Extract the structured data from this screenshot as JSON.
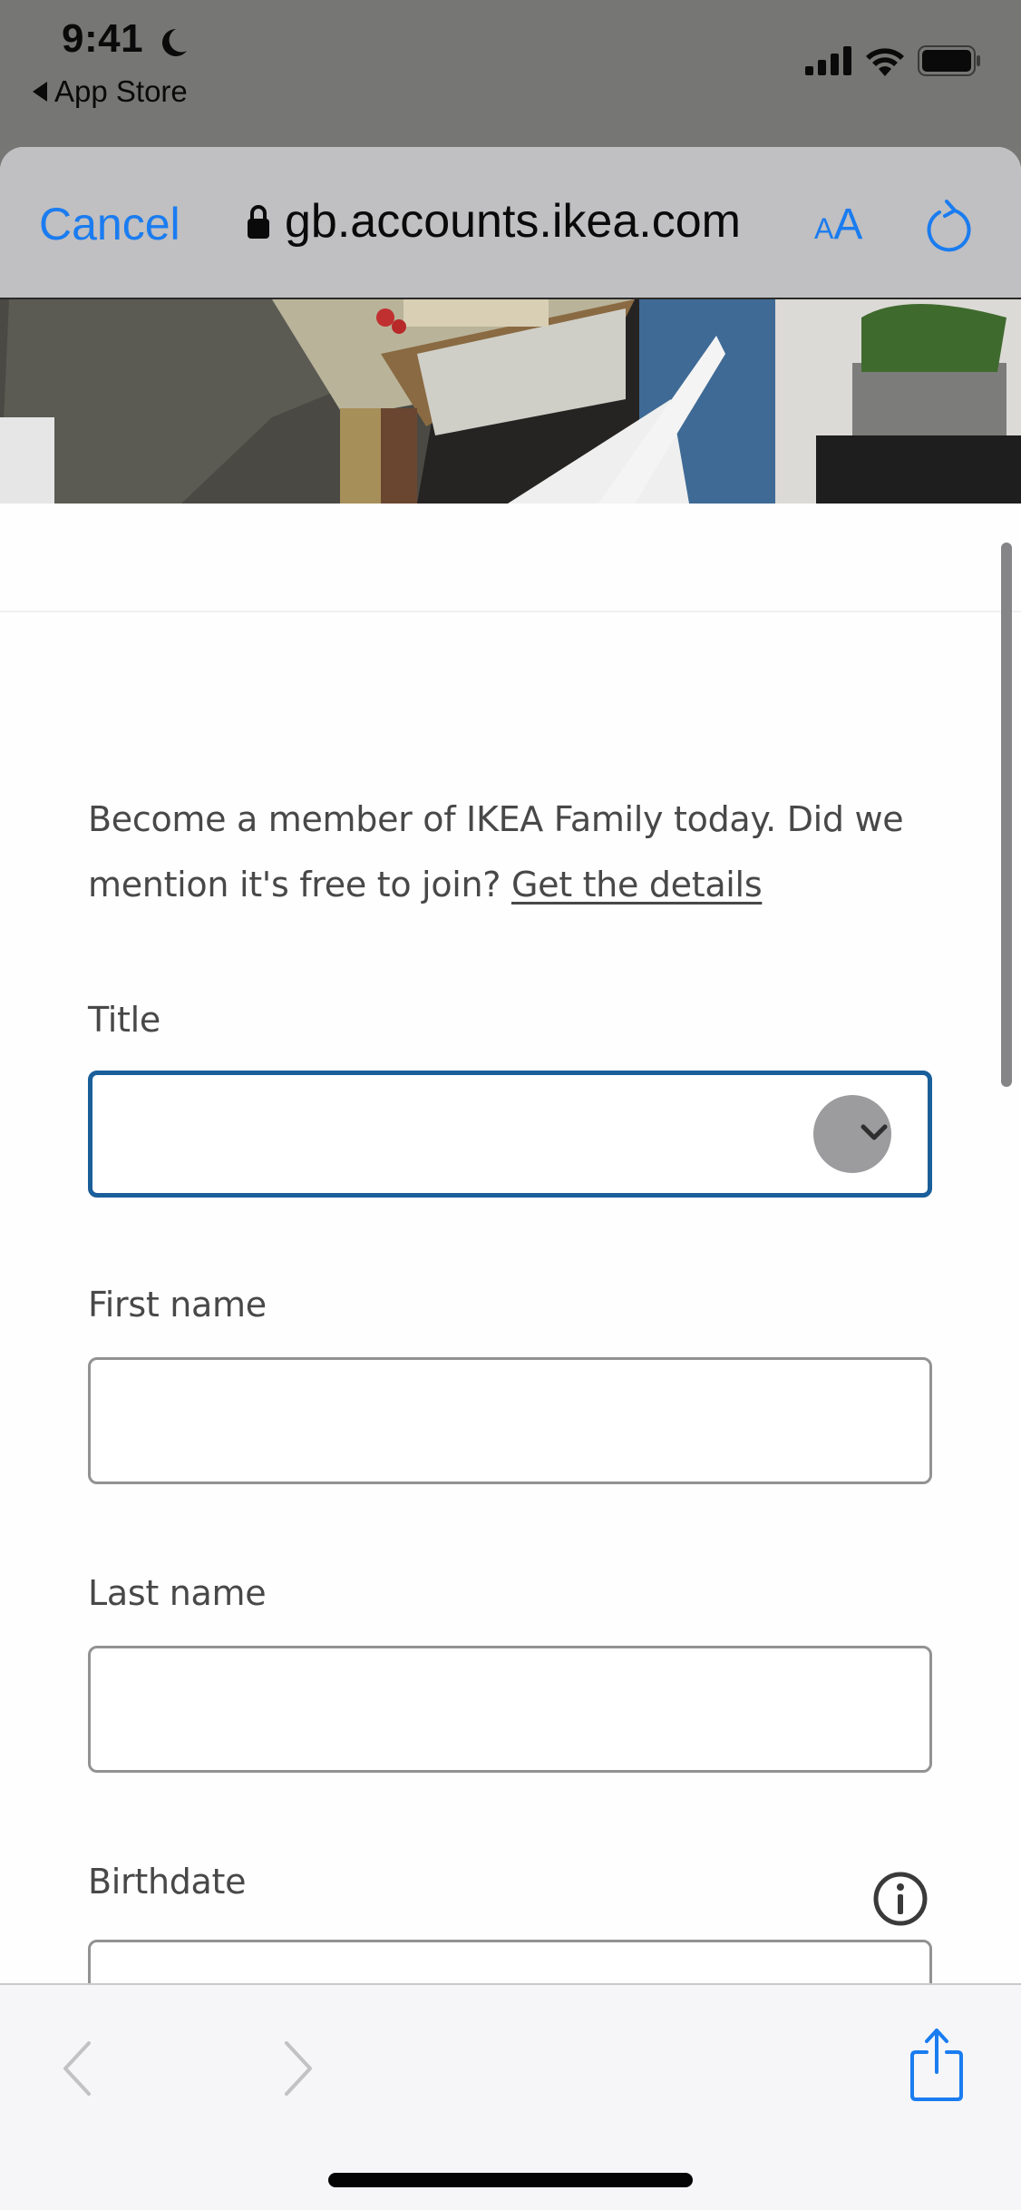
{
  "status_bar": {
    "time": "9:41",
    "back_app_label": "App Store",
    "icons": [
      "moon-icon",
      "cellular-signal-icon",
      "wifi-icon",
      "battery-icon"
    ]
  },
  "browser": {
    "cancel_label": "Cancel",
    "url": "gb.accounts.ikea.com",
    "text_size_small": "A",
    "text_size_large": "A",
    "accent_color": "#1a7cf0"
  },
  "page": {
    "intro_text": "Become a member of IKEA Family today. Did we mention it's free to join? ",
    "intro_link": "Get the details",
    "fields": {
      "title": {
        "label": "Title",
        "value": ""
      },
      "first_name": {
        "label": "First name",
        "value": ""
      },
      "last_name": {
        "label": "Last name",
        "value": ""
      },
      "birthdate": {
        "label": "Birthdate",
        "value": ""
      }
    },
    "focus_color": "#1a5e9a"
  },
  "toolbar": {
    "icons": [
      "back-arrow-icon",
      "forward-arrow-icon",
      "share-icon"
    ]
  }
}
